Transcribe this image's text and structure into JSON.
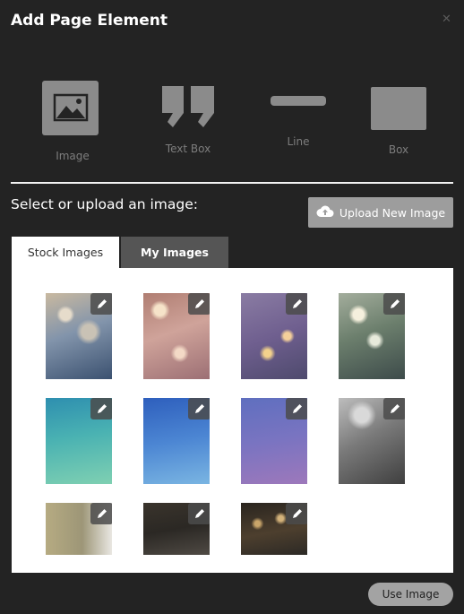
{
  "dialog": {
    "title": "Add Page Element"
  },
  "element_types": [
    {
      "label": "Image",
      "icon": "image-icon"
    },
    {
      "label": "Text Box",
      "icon": "quote-icon"
    },
    {
      "label": "Line",
      "icon": "line-icon"
    },
    {
      "label": "Box",
      "icon": "box-icon"
    }
  ],
  "images_section": {
    "title": "Select or upload an image:",
    "upload_label": "Upload New Image",
    "upload_icon": "cloud-upload-icon"
  },
  "tabs": [
    {
      "label": "Stock Images",
      "active": true
    },
    {
      "label": "My Images",
      "active": false
    }
  ],
  "stock_images": [
    {
      "description": "blue bokeh lights",
      "edit_icon": "pencil-icon"
    },
    {
      "description": "pink bokeh lights",
      "edit_icon": "pencil-icon"
    },
    {
      "description": "purple bokeh lights",
      "edit_icon": "pencil-icon"
    },
    {
      "description": "green bokeh lights",
      "edit_icon": "pencil-icon"
    },
    {
      "description": "teal gradient",
      "edit_icon": "pencil-icon"
    },
    {
      "description": "blue gradient",
      "edit_icon": "pencil-icon"
    },
    {
      "description": "purple gradient",
      "edit_icon": "pencil-icon"
    },
    {
      "description": "grayscale photo",
      "edit_icon": "pencil-icon"
    },
    {
      "description": "olive blurred photo",
      "edit_icon": "pencil-icon"
    },
    {
      "description": "dark interior",
      "edit_icon": "pencil-icon"
    },
    {
      "description": "bar interior",
      "edit_icon": "pencil-icon"
    }
  ],
  "footer": {
    "use_label": "Use Image"
  },
  "colors": {
    "background": "#232323",
    "icon_gray": "#8b8b8b",
    "button_gray": "#9d9d9d"
  }
}
